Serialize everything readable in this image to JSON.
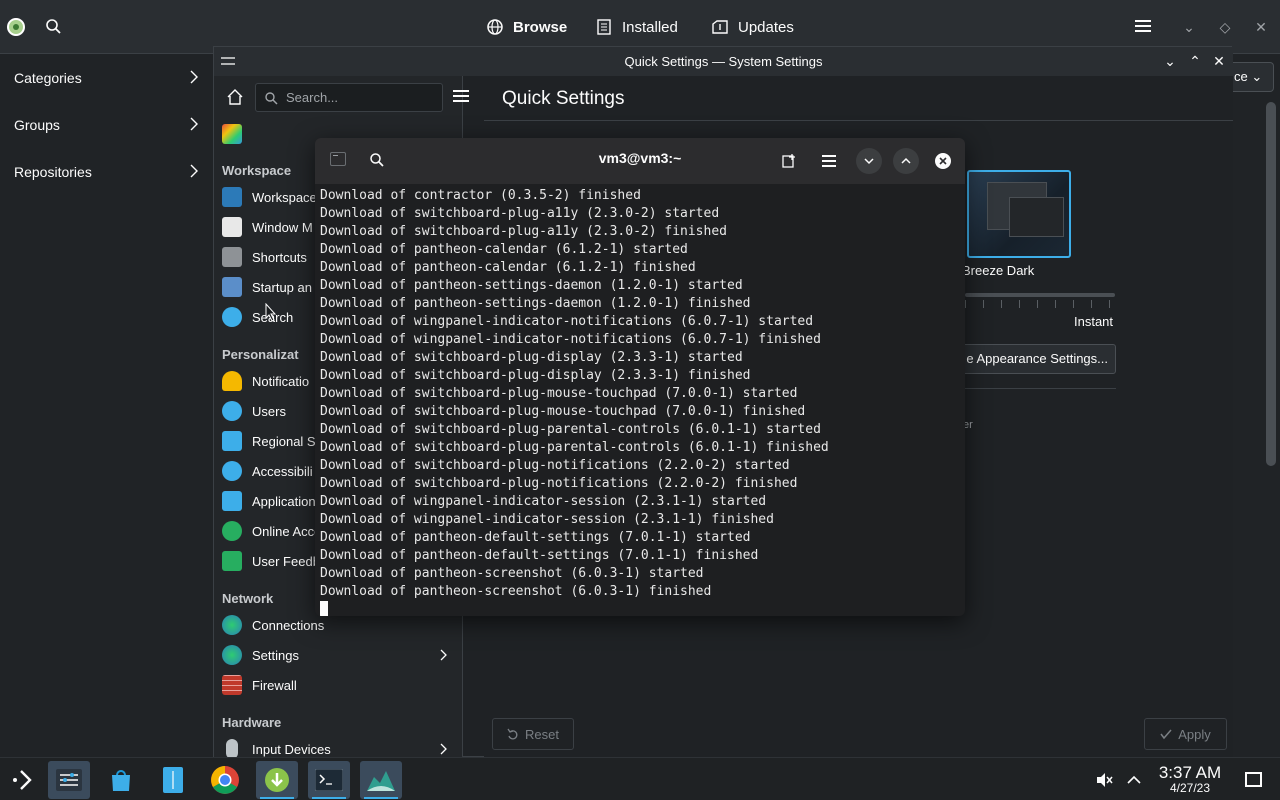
{
  "discover": {
    "tabs": [
      {
        "label": "Browse",
        "icon": "globe-icon"
      },
      {
        "label": "Installed",
        "icon": "list-icon"
      },
      {
        "label": "Updates",
        "icon": "updates-icon"
      }
    ],
    "nav": [
      {
        "label": "Categories"
      },
      {
        "label": "Groups"
      },
      {
        "label": "Repositories"
      }
    ],
    "dropdown_fragment": "ce"
  },
  "settings": {
    "window_title": "Quick Settings — System Settings",
    "search_placeholder": "Search...",
    "page_title": "Quick Settings",
    "sections": {
      "workspace": "Workspace",
      "personalization": "Personalizat",
      "network": "Network",
      "hardware": "Hardware"
    },
    "items": {
      "workspace": [
        {
          "label": "Workspace",
          "color": "#2c7ab8"
        },
        {
          "label": "Window M",
          "color": "#e8e8e8"
        },
        {
          "label": "Shortcuts",
          "color": "#8e9296"
        },
        {
          "label": "Startup an",
          "color": "#5b8ec9"
        },
        {
          "label": "Search",
          "color": "#3daee9"
        }
      ],
      "personalization": [
        {
          "label": "Notificatio",
          "color": "#f5b800"
        },
        {
          "label": "Users",
          "color": "#3daee9"
        },
        {
          "label": "Regional S",
          "color": "#3daee9"
        },
        {
          "label": "Accessibili",
          "color": "#3daee9"
        },
        {
          "label": "Application",
          "color": "#3daee9"
        },
        {
          "label": "Online Acco",
          "color": "#27ae60"
        },
        {
          "label": "User Feedb",
          "color": "#27ae60"
        }
      ],
      "network": [
        {
          "label": "Connections",
          "color": "#3daee9"
        },
        {
          "label": "Settings",
          "color": "#3daee9"
        },
        {
          "label": "Firewall",
          "color": "#c0392b"
        }
      ],
      "hardware": [
        {
          "label": "Input Devices",
          "color": "#bdc3c7"
        }
      ]
    },
    "theme_name": "Breeze Dark",
    "animation_label": "Instant",
    "appearance_button": "e Appearance Settings...",
    "partial_text": "er",
    "reset_label": "Reset",
    "apply_label": "Apply"
  },
  "terminal": {
    "title": "vm3@vm3:~",
    "lines": [
      "Download of contractor (0.3.5-2) finished",
      "Download of switchboard-plug-a11y (2.3.0-2) started",
      "Download of switchboard-plug-a11y (2.3.0-2) finished",
      "Download of pantheon-calendar (6.1.2-1) started",
      "Download of pantheon-calendar (6.1.2-1) finished",
      "Download of pantheon-settings-daemon (1.2.0-1) started",
      "Download of pantheon-settings-daemon (1.2.0-1) finished",
      "Download of wingpanel-indicator-notifications (6.0.7-1) started",
      "Download of wingpanel-indicator-notifications (6.0.7-1) finished",
      "Download of switchboard-plug-display (2.3.3-1) started",
      "Download of switchboard-plug-display (2.3.3-1) finished",
      "Download of switchboard-plug-mouse-touchpad (7.0.0-1) started",
      "Download of switchboard-plug-mouse-touchpad (7.0.0-1) finished",
      "Download of switchboard-plug-parental-controls (6.0.1-1) started",
      "Download of switchboard-plug-parental-controls (6.0.1-1) finished",
      "Download of switchboard-plug-notifications (2.2.0-2) started",
      "Download of switchboard-plug-notifications (2.2.0-2) finished",
      "Download of wingpanel-indicator-session (2.3.1-1) started",
      "Download of wingpanel-indicator-session (2.3.1-1) finished",
      "Download of pantheon-default-settings (7.0.1-1) started",
      "Download of pantheon-default-settings (7.0.1-1) finished",
      "Download of pantheon-screenshot (6.0.3-1) started",
      "Download of pantheon-screenshot (6.0.3-1) finished"
    ]
  },
  "taskbar": {
    "apps": [
      {
        "name": "application-launcher"
      },
      {
        "name": "system-settings"
      },
      {
        "name": "discover-store"
      },
      {
        "name": "file-manager"
      },
      {
        "name": "chrome"
      },
      {
        "name": "software-updater"
      },
      {
        "name": "terminal"
      },
      {
        "name": "system-monitor"
      }
    ],
    "time": "3:37 AM",
    "date": "4/27/23"
  }
}
